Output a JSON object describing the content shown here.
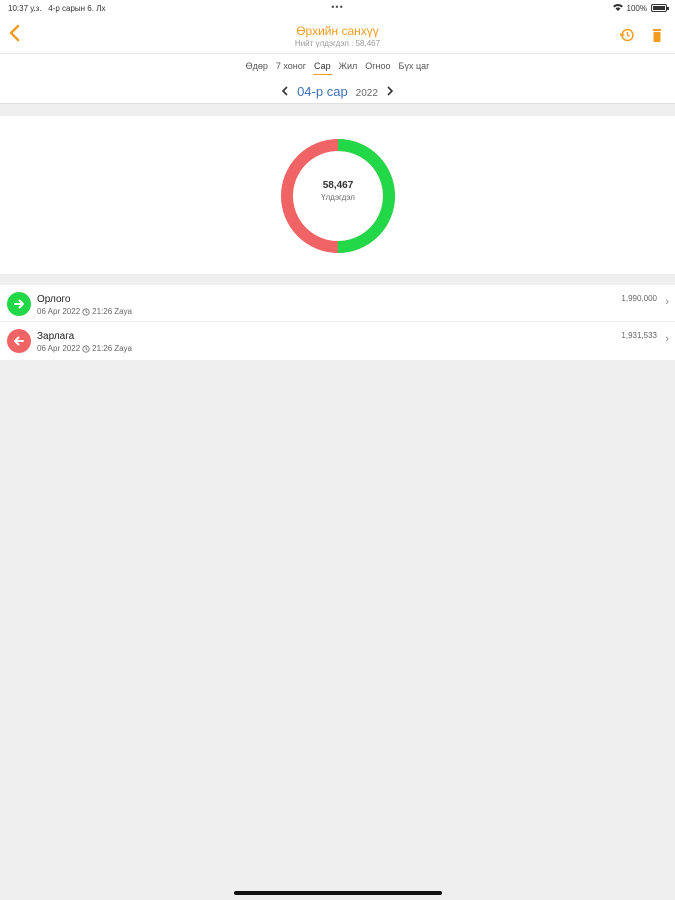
{
  "status_bar": {
    "time": "10:37 у.з.",
    "date": "4-р сарын 6. Лх",
    "dots": "•••",
    "battery": "100%"
  },
  "nav": {
    "title": "Өрхийн санхүү",
    "subtitle": "Нийт үлдэгдэл : 58,467"
  },
  "tabs": [
    {
      "label": "Өдөр",
      "active": false
    },
    {
      "label": "7 хоног",
      "active": false
    },
    {
      "label": "Сар",
      "active": true
    },
    {
      "label": "Жил",
      "active": false
    },
    {
      "label": "Огноо",
      "active": false
    },
    {
      "label": "Бүх цаг",
      "active": false
    }
  ],
  "period": {
    "month": "04-р сар",
    "year": "2022"
  },
  "chart": {
    "value": "58,467",
    "label": "Үлдэгдэл",
    "green_share": 0.5,
    "red_share": 0.5,
    "green_color": "#22d849",
    "red_color": "#f06465"
  },
  "transactions": [
    {
      "title": "Орлого",
      "date": "06 Apr 2022",
      "time": "21:26",
      "user": "Zaya",
      "amount": "1,990,000",
      "type": "income",
      "icon": "arrow-right-icon"
    },
    {
      "title": "Зарлага",
      "date": "06 Apr 2022",
      "time": "21:26",
      "user": "Zaya",
      "amount": "1,931,533",
      "type": "expense",
      "icon": "arrow-left-icon"
    }
  ],
  "colors": {
    "accent": "#f39c1f",
    "month_link": "#3b6fb5"
  }
}
